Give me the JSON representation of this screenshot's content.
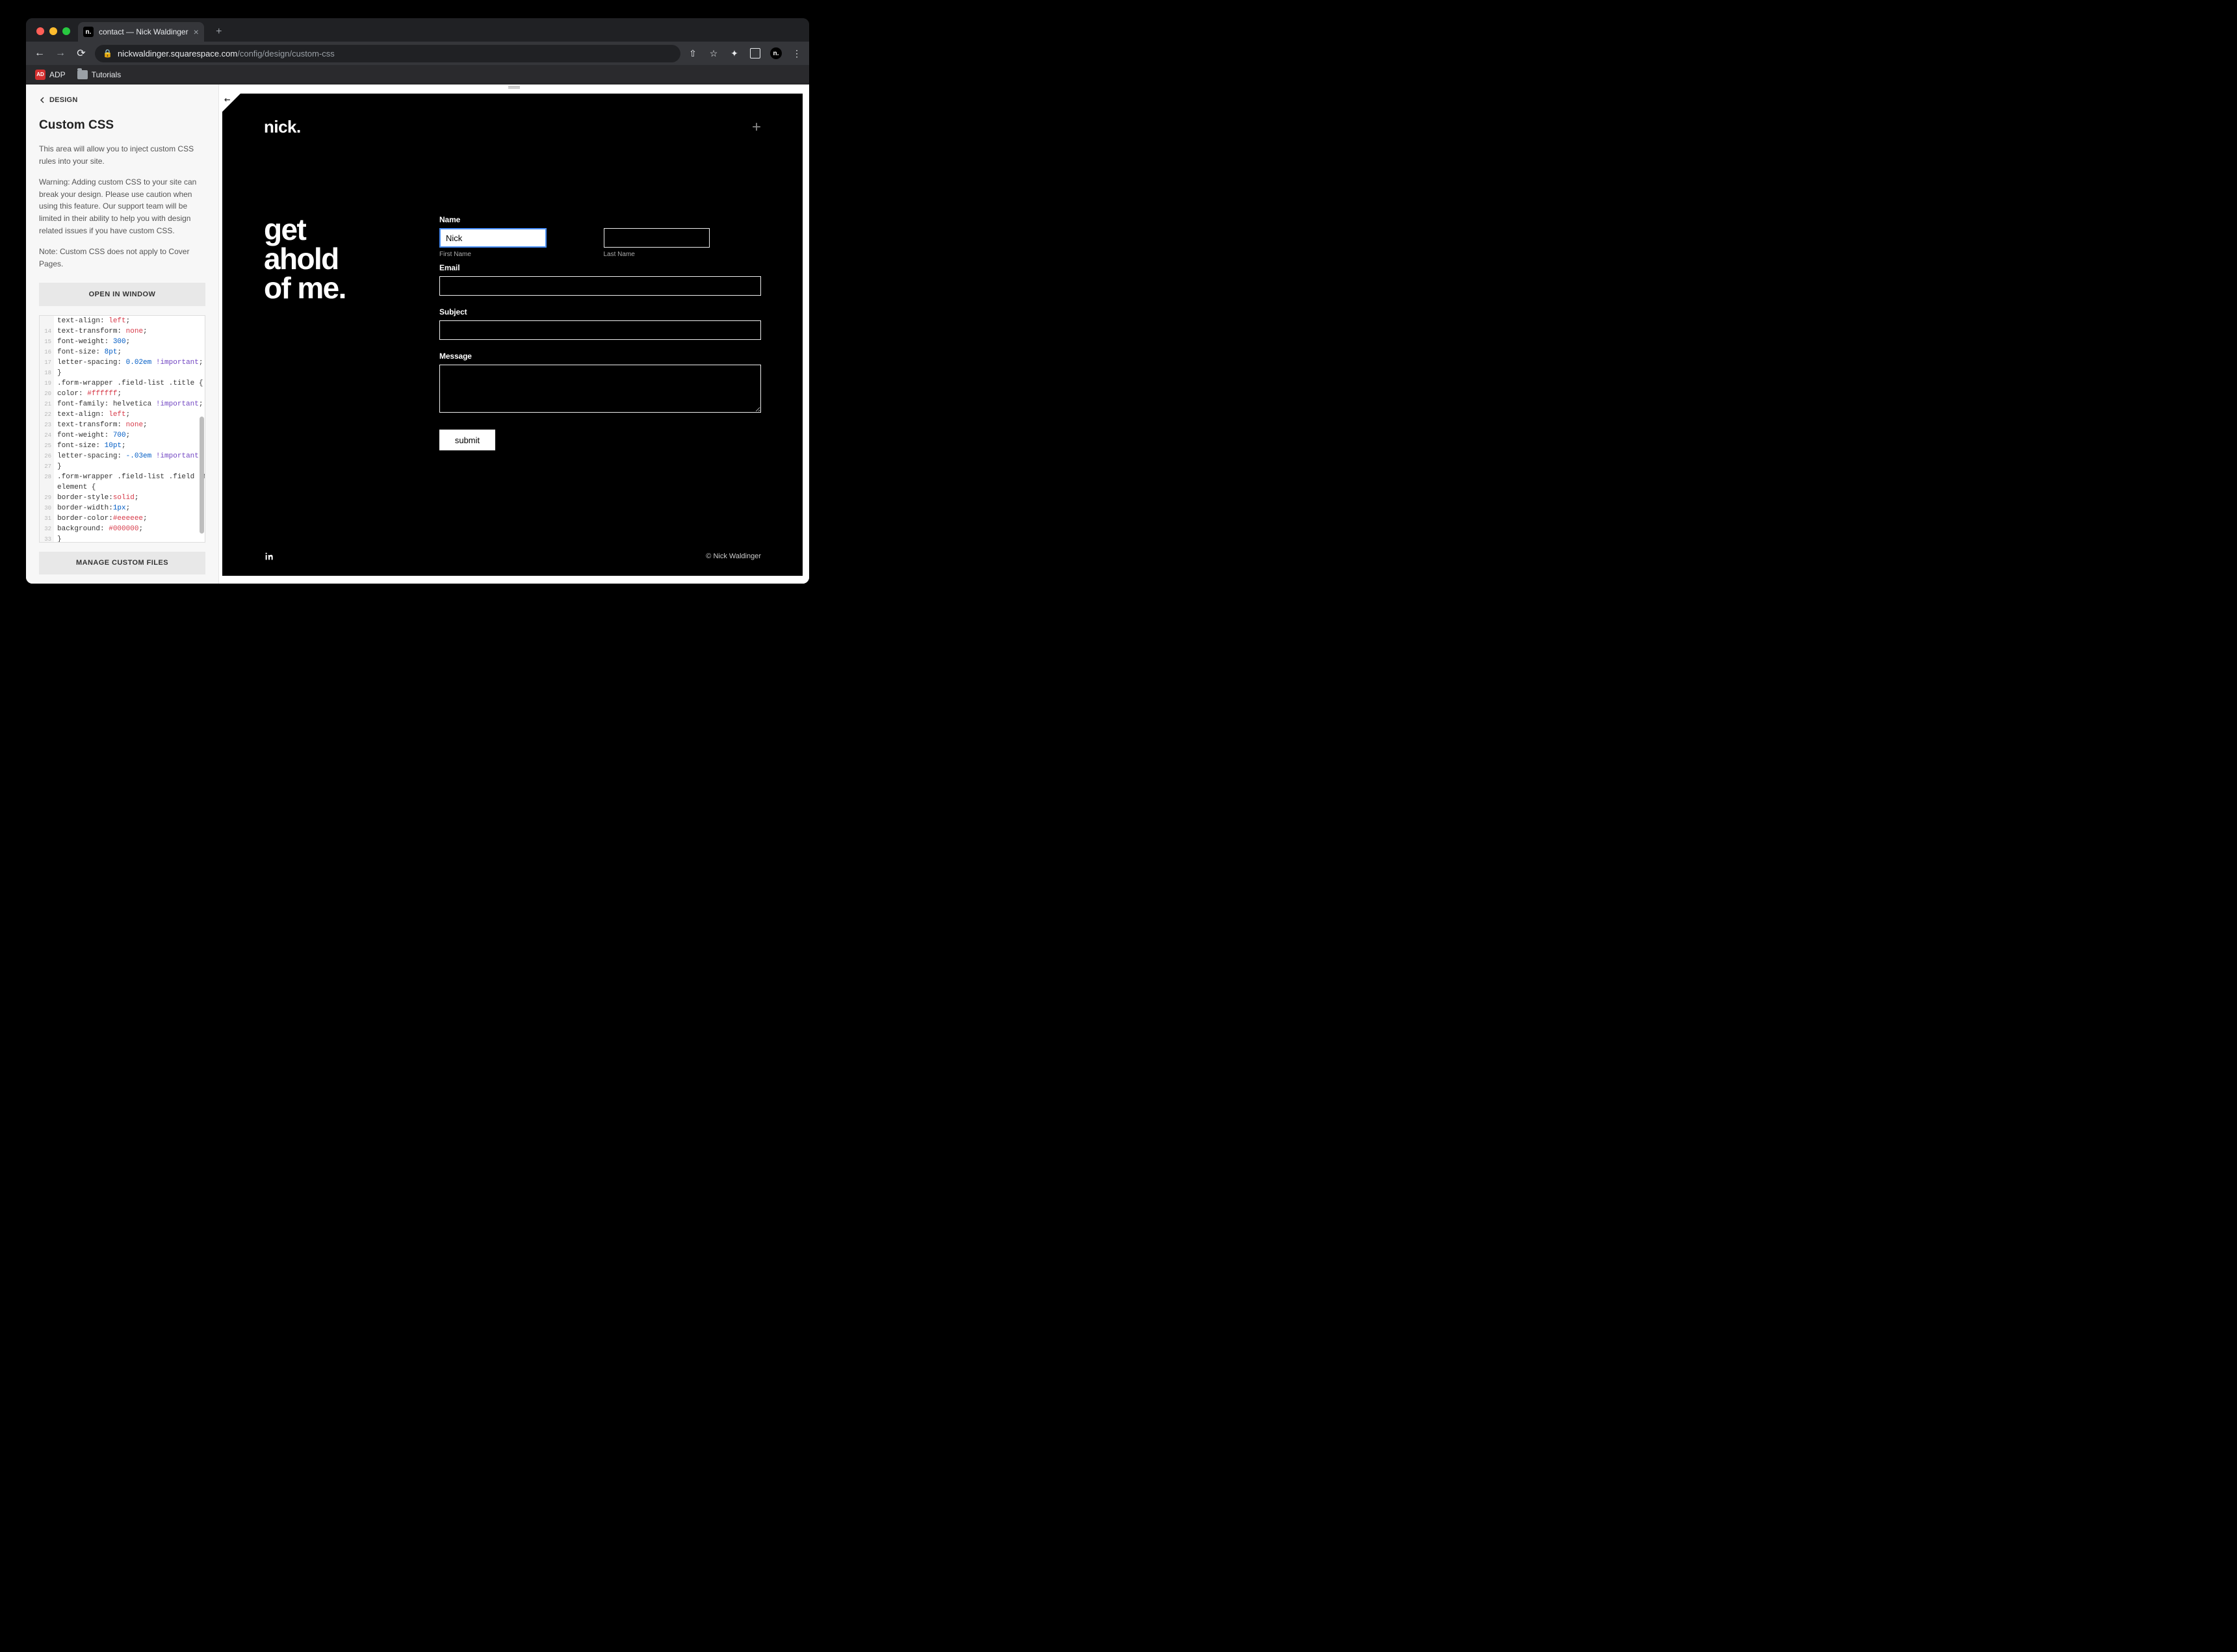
{
  "browser": {
    "tab_title": "contact — Nick Waldinger",
    "url_host": "nickwaldinger.squarespace.com",
    "url_path": "/config/design/custom-css",
    "bookmarks": [
      {
        "label": "ADP",
        "favicon": "adp"
      },
      {
        "label": "Tutorials",
        "favicon": "folder"
      }
    ]
  },
  "panel": {
    "back_label": "DESIGN",
    "title": "Custom CSS",
    "intro": "This area will allow you to inject custom CSS rules into your site.",
    "warning": "Warning: Adding custom CSS to your site can break your design. Please use caution when using this feature. Our support team will be limited in their ability to help you with design related issues if you have custom CSS.",
    "note": "Note: Custom CSS does not apply to Cover Pages.",
    "open_button": "OPEN IN WINDOW",
    "manage_button": "MANAGE CUSTOM FILES"
  },
  "code": {
    "lines": [
      {
        "n": "",
        "html": "<span class='tok-prop'>text-align:</span> <span class='tok-kw'>left</span>;"
      },
      {
        "n": "14",
        "html": "<span class='tok-prop'>text-transform:</span> <span class='tok-kw'>none</span>;"
      },
      {
        "n": "15",
        "html": "<span class='tok-prop'>font-weight:</span> <span class='tok-num'>300</span>;"
      },
      {
        "n": "16",
        "html": "<span class='tok-prop'>font-size:</span> <span class='tok-num'>8pt</span>;"
      },
      {
        "n": "17",
        "html": "<span class='tok-prop'>letter-spacing:</span> <span class='tok-num'>0.02em</span> <span class='tok-imp'>!important</span>;"
      },
      {
        "n": "18",
        "html": "}"
      },
      {
        "n": "19",
        "html": "<span class='tok-sel'>.form-wrapper .field-list .title {</span>"
      },
      {
        "n": "20",
        "html": "<span class='tok-prop'>color:</span> <span class='tok-hex'>#ffffff</span>;"
      },
      {
        "n": "21",
        "html": "<span class='tok-prop'>font-family:</span> helvetica <span class='tok-imp'>!important</span>;"
      },
      {
        "n": "22",
        "html": "<span class='tok-prop'>text-align:</span> <span class='tok-kw'>left</span>;"
      },
      {
        "n": "23",
        "html": "<span class='tok-prop'>text-transform:</span> <span class='tok-kw'>none</span>;"
      },
      {
        "n": "24",
        "html": "<span class='tok-prop'>font-weight:</span> <span class='tok-num'>700</span>;"
      },
      {
        "n": "25",
        "html": "<span class='tok-prop'>font-size:</span> <span class='tok-num'>10pt</span>;"
      },
      {
        "n": "26",
        "html": "<span class='tok-prop'>letter-spacing:</span> <span class='tok-num'>-.03em</span> <span class='tok-imp'>!important</span>;"
      },
      {
        "n": "27",
        "html": "}"
      },
      {
        "n": "28",
        "html": "<span class='tok-sel'>.form-wrapper .field-list .field .field-</span>"
      },
      {
        "n": "",
        "html": "<span class='tok-sel'>element {</span>"
      },
      {
        "n": "29",
        "html": "<span class='tok-prop'>border-style:</span><span class='tok-kw'>solid</span>;"
      },
      {
        "n": "30",
        "html": "<span class='tok-prop'>border-width:</span><span class='tok-num'>1px</span>;"
      },
      {
        "n": "31",
        "html": "<span class='tok-prop'>border-color:</span><span class='tok-hex'>#eeeeee</span>;"
      },
      {
        "n": "32",
        "html": "<span class='tok-prop'>background:</span> <span class='tok-hex'>#000000</span>;"
      },
      {
        "n": "33",
        "html": "}"
      }
    ]
  },
  "site": {
    "logo": "nick.",
    "hero_line1": "get",
    "hero_line2": "ahold",
    "hero_line3": "of me.",
    "form": {
      "name_label": "Name",
      "first_name_value": "Nick",
      "first_name_caption": "First Name",
      "last_name_caption": "Last Name",
      "email_label": "Email",
      "subject_label": "Subject",
      "message_label": "Message",
      "submit_label": "submit"
    },
    "footer_copy": "© Nick Waldinger"
  }
}
